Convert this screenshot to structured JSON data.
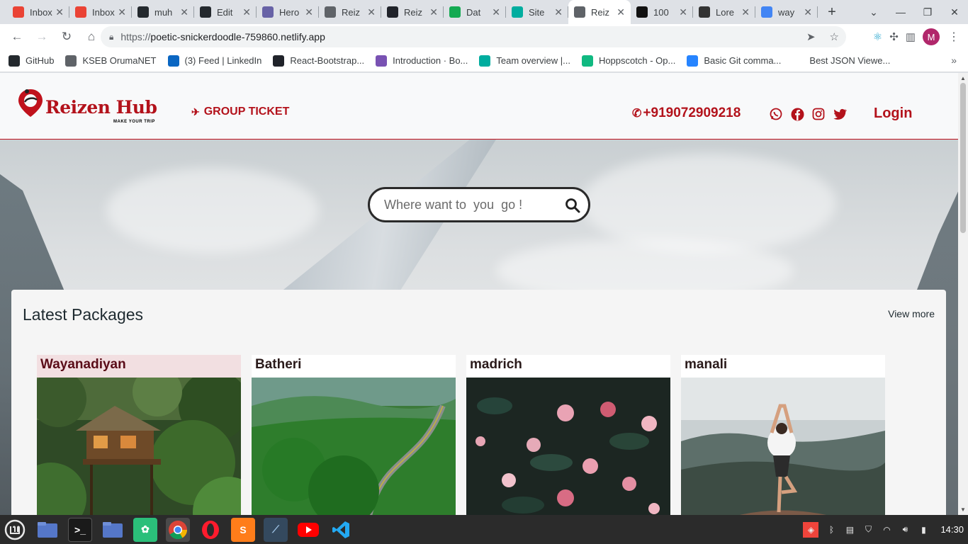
{
  "browser": {
    "tabs": [
      {
        "title": "Inbox",
        "icon": "gmail-icon",
        "color": "#ea4335"
      },
      {
        "title": "Inbox",
        "icon": "gmail-icon",
        "color": "#ea4335"
      },
      {
        "title": "muh",
        "icon": "github-icon",
        "color": "#24292e"
      },
      {
        "title": "Edit",
        "icon": "github-icon",
        "color": "#24292e"
      },
      {
        "title": "Hero",
        "icon": "heroku-icon",
        "color": "#6762a6"
      },
      {
        "title": "Reiz",
        "icon": "globe-icon",
        "color": "#5f6368"
      },
      {
        "title": "Reiz",
        "icon": "react-icon",
        "color": "#20232a"
      },
      {
        "title": "Dat",
        "icon": "mongodb-icon",
        "color": "#13aa52"
      },
      {
        "title": "Site",
        "icon": "netlify-icon",
        "color": "#00ad9f"
      },
      {
        "title": "Reiz",
        "icon": "globe-icon",
        "color": "#5f6368",
        "active": true
      },
      {
        "title": "100",
        "icon": "unsplash-icon",
        "color": "#111111"
      },
      {
        "title": "Lore",
        "icon": "lorem-icon",
        "color": "#333333"
      },
      {
        "title": "way",
        "icon": "google-icon",
        "color": "#4285f4"
      }
    ],
    "url_scheme": "https://",
    "url_host": "poetic-snickerdoodle-759860.netlify.app",
    "profile_initial": "M",
    "bookmarks": [
      {
        "label": "GitHub",
        "icon": "github-icon",
        "color": "#24292e"
      },
      {
        "label": "KSEB OrumaNET",
        "icon": "globe-icon",
        "color": "#5f6368"
      },
      {
        "label": "(3) Feed | LinkedIn",
        "icon": "linkedin-icon",
        "color": "#0a66c2"
      },
      {
        "label": "React-Bootstrap...",
        "icon": "react-bootstrap-icon",
        "color": "#20232a"
      },
      {
        "label": "Introduction · Bo...",
        "icon": "bootstrap-icon",
        "color": "#7952b3"
      },
      {
        "label": "Team overview |...",
        "icon": "netlify-icon",
        "color": "#00ad9f"
      },
      {
        "label": "Hoppscotch - Op...",
        "icon": "hoppscotch-icon",
        "color": "#10b981"
      },
      {
        "label": "Basic Git comma...",
        "icon": "atlassian-icon",
        "color": "#2684ff"
      },
      {
        "label": "Best JSON Viewe...",
        "icon": "codebeautify-icon",
        "color": "#ffffff"
      }
    ]
  },
  "site": {
    "brand": "Reizen Hub",
    "tagline": "MAKE YOUR TRIP",
    "nav_group_ticket": "GROUP TICKET",
    "phone": "+919072909218",
    "social_icons": [
      "whatsapp-icon",
      "facebook-icon",
      "instagram-icon",
      "twitter-icon"
    ],
    "login": "Login",
    "search_placeholder": "Where want to  you  go !",
    "packages_title": "Latest Packages",
    "view_more": "View more",
    "packages": [
      {
        "name": "Wayanadiyan"
      },
      {
        "name": "Batheri"
      },
      {
        "name": "madrich"
      },
      {
        "name": "manali"
      }
    ],
    "brand_color": "#b3121b"
  },
  "taskbar": {
    "apps": [
      "mint-menu-icon",
      "files-icon",
      "terminal-icon",
      "files-2-icon",
      "mintinstall-icon",
      "chrome-icon",
      "opera-icon",
      "sublime-icon",
      "mysql-workbench-icon",
      "youtube-icon",
      "vscode-icon"
    ],
    "clock": "14:30"
  }
}
